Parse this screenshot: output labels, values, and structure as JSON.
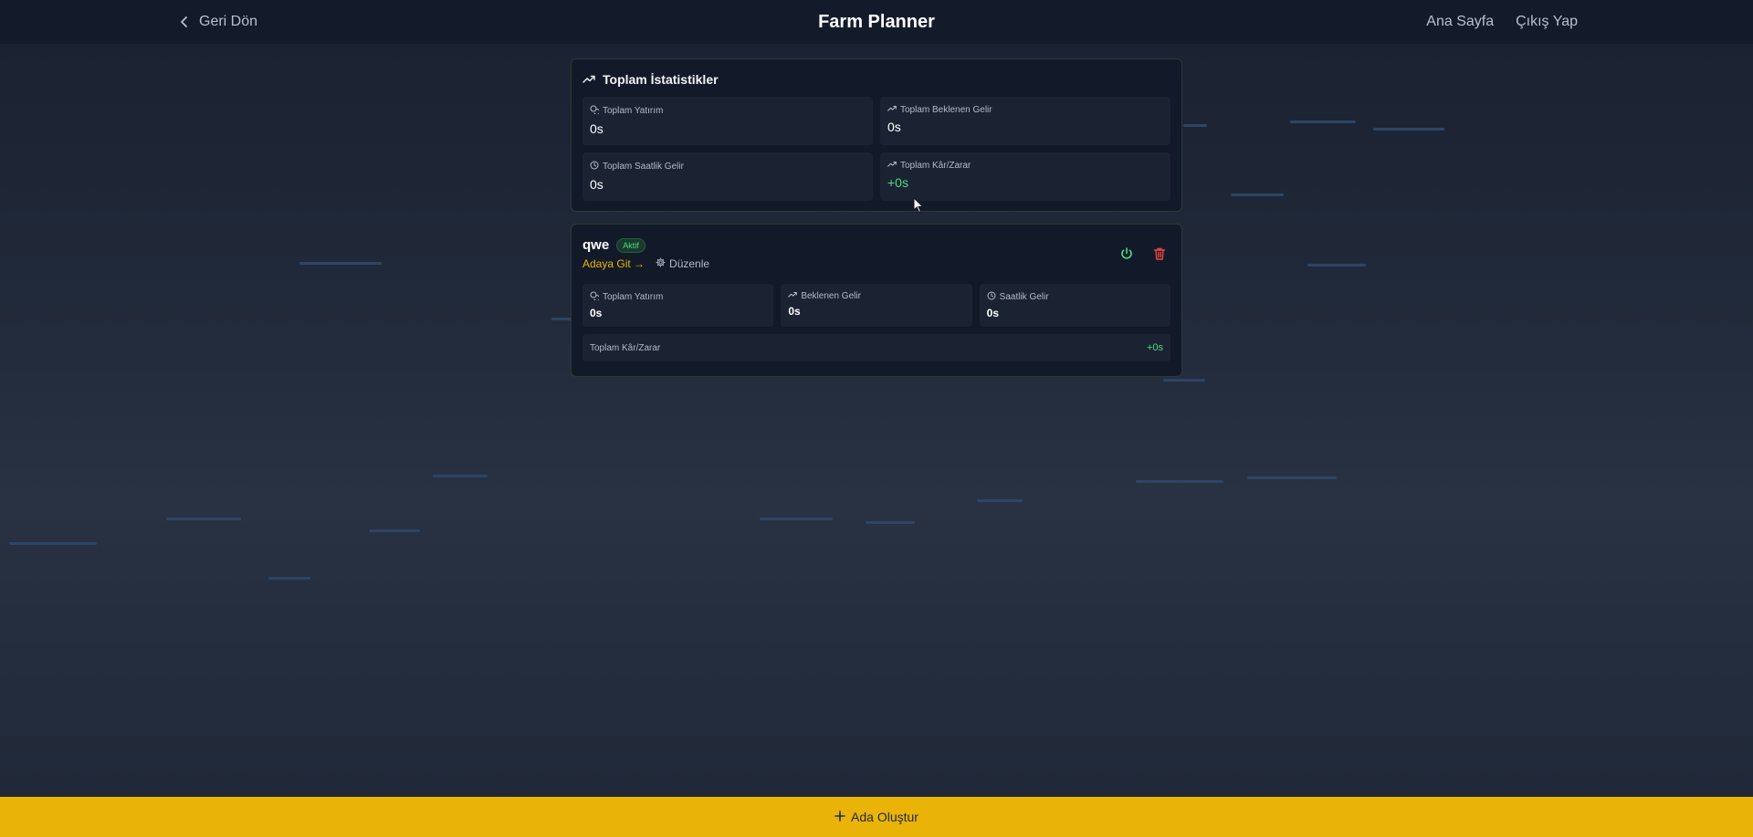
{
  "header": {
    "back_label": "Geri Dön",
    "title": "Farm Planner",
    "links": [
      "Ana Sayfa",
      "Çıkış Yap"
    ]
  },
  "stats": {
    "title": "Toplam İstatistikler",
    "items": [
      {
        "label": "Toplam Yatırım",
        "value": "0s",
        "icon": "coins-icon"
      },
      {
        "label": "Toplam Beklenen Gelir",
        "value": "0s",
        "icon": "trending-up-icon"
      },
      {
        "label": "Toplam Saatlik Gelir",
        "value": "0s",
        "icon": "clock-icon"
      },
      {
        "label": "Toplam Kâr/Zarar",
        "value": "+0s",
        "icon": "trending-up-icon"
      }
    ]
  },
  "island": {
    "name": "qwe",
    "status": "Aktif",
    "go_label": "Adaya Git →",
    "edit_label": "Düzenle",
    "stats": [
      {
        "label": "Toplam Yatırım",
        "value": "0s",
        "icon": "coins-icon"
      },
      {
        "label": "Beklenen Gelir",
        "value": "0s",
        "icon": "trending-up-icon"
      },
      {
        "label": "Saatlik Gelir",
        "value": "0s",
        "icon": "clock-icon"
      }
    ],
    "profit_label": "Toplam Kâr/Zarar",
    "profit_value": "+0s"
  },
  "footer": {
    "create_label": "Ada Oluştur"
  },
  "colors": {
    "accent": "#eab308",
    "positive": "#4ade80",
    "danger": "#ef4444"
  }
}
